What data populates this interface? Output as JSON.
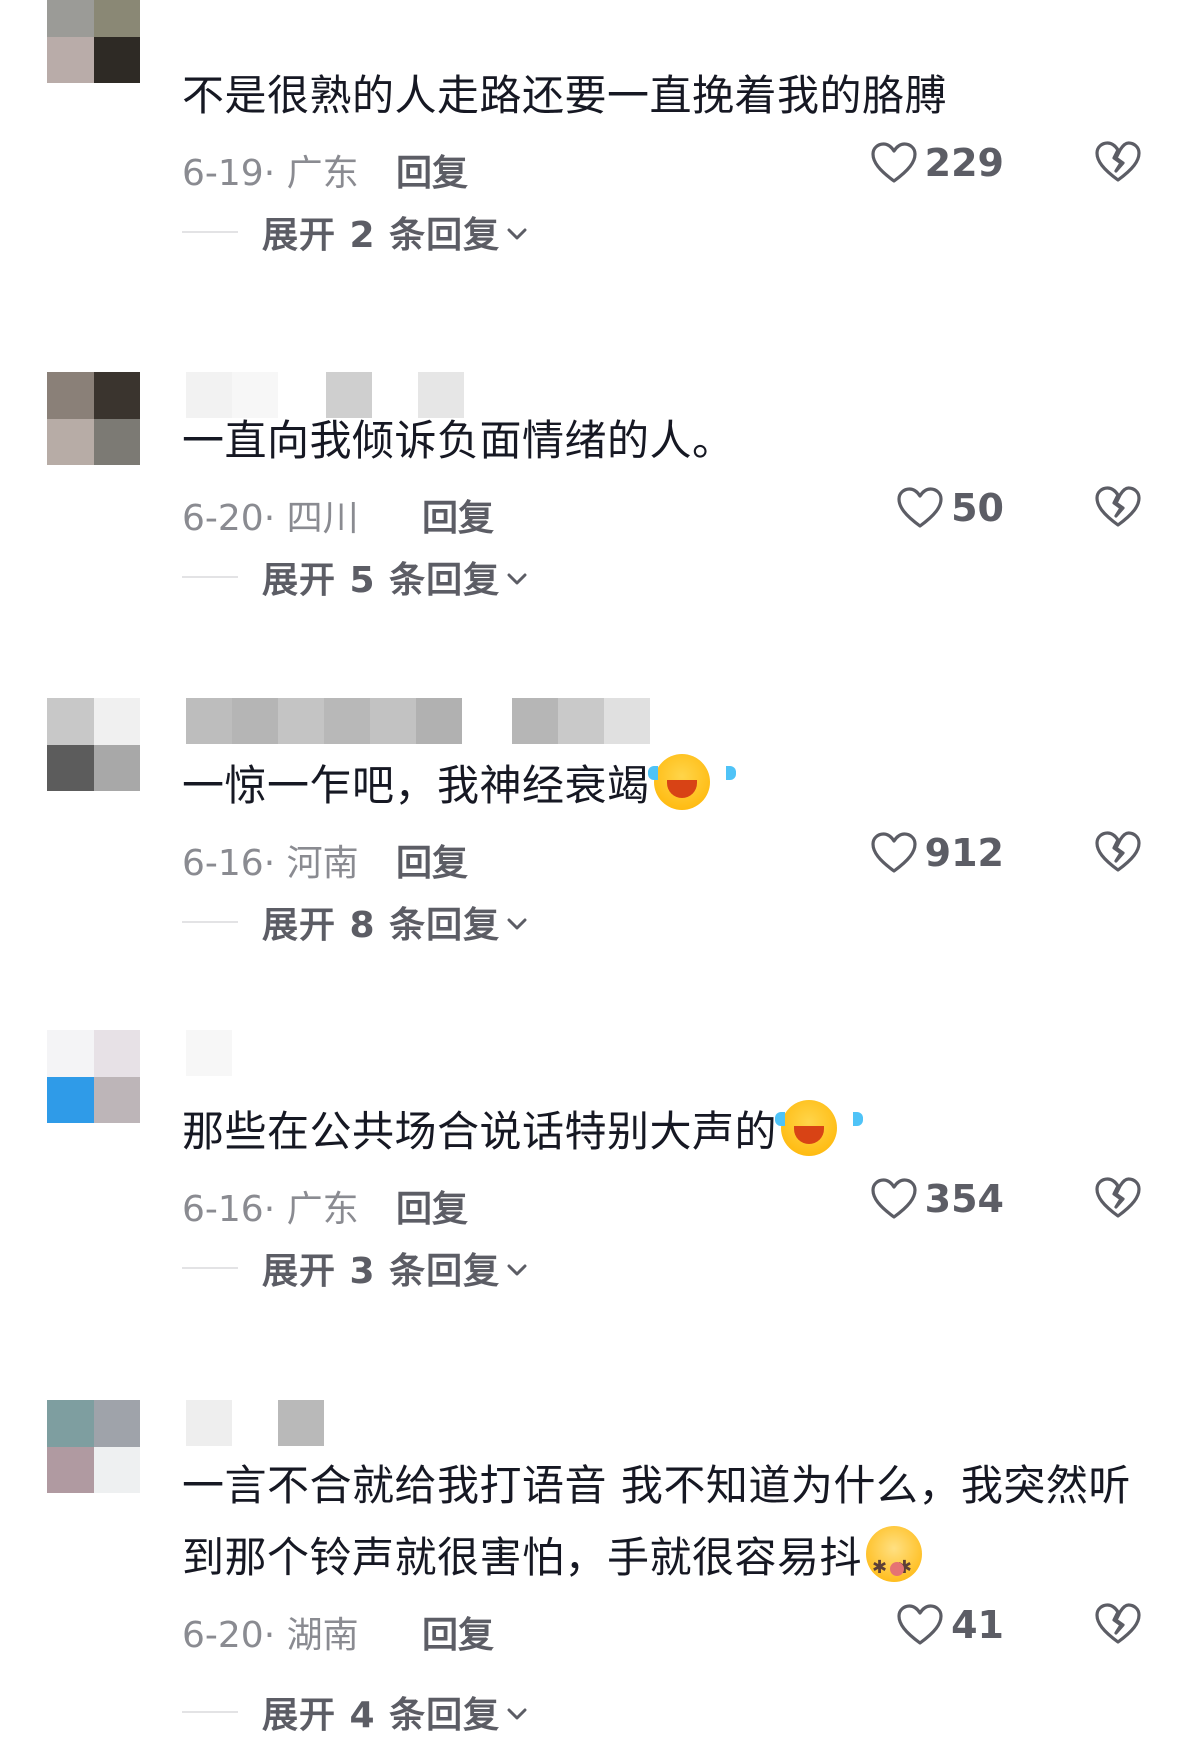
{
  "comments": [
    {
      "text": "不是很熟的人走路还要一直挽着我的胳膊",
      "date": "6-19",
      "location": "· 广东",
      "reply_label": "回复",
      "likes": "229",
      "expand_label": "展开 2 条回复",
      "emoji": null
    },
    {
      "text": "一直向我倾诉负面情绪的人。",
      "date": "6-20",
      "location": "· 四川",
      "reply_label": "回复",
      "likes": "50",
      "expand_label": "展开 5 条回复",
      "emoji": null
    },
    {
      "text": "一惊一乍吧，我神经衰竭",
      "date": "6-16",
      "location": "· 河南",
      "reply_label": "回复",
      "likes": "912",
      "expand_label": "展开 8 条回复",
      "emoji": "laugh-cry-emoji"
    },
    {
      "text": "那些在公共场合说话特别大声的",
      "date": "6-16",
      "location": "· 广东",
      "reply_label": "回复",
      "likes": "354",
      "expand_label": "展开 3 条回复",
      "emoji": "laugh-cry-emoji"
    },
    {
      "text": "一言不合就给我打语音 我不知道为什么，我突然听到那个铃声就很害怕，手就很容易抖",
      "date": "6-20",
      "location": "· 湖南",
      "reply_label": "回复",
      "likes": "41",
      "expand_label": "展开 4 条回复",
      "emoji": "dizzy-face-emoji"
    }
  ],
  "colors": {
    "text_primary": "#161823",
    "text_secondary": "#8a8b91",
    "text_action": "#5c5d65",
    "divider": "#e3e3e5"
  }
}
